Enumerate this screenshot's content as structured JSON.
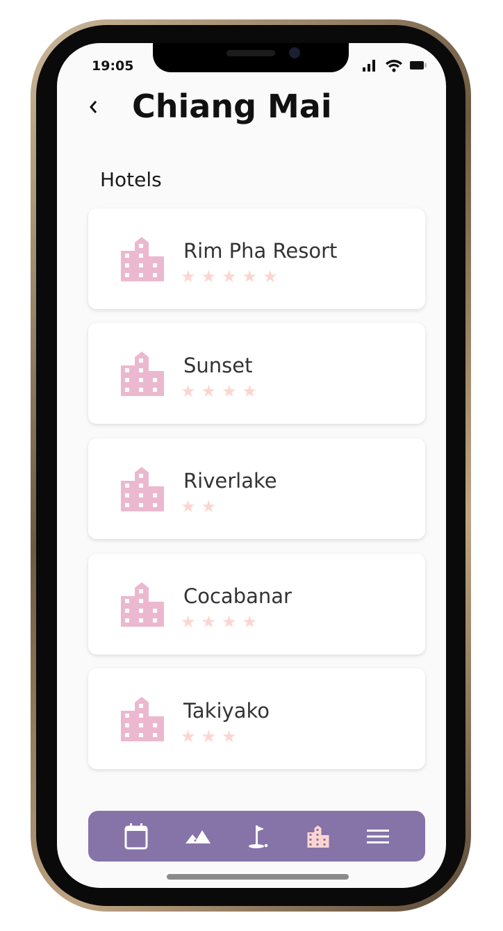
{
  "status_bar": {
    "time": "19:05"
  },
  "header": {
    "title": "Chiang Mai"
  },
  "section_title": "Hotels",
  "hotels": [
    {
      "name": "Rim Pha Resort",
      "stars": 5,
      "stars_text": "★★★★★"
    },
    {
      "name": "Sunset",
      "stars": 4,
      "stars_text": "★★★★"
    },
    {
      "name": "Riverlake",
      "stars": 2,
      "stars_text": "★★"
    },
    {
      "name": "Cocabanar",
      "stars": 4,
      "stars_text": "★★★★"
    },
    {
      "name": "Takiyako",
      "stars": 3,
      "stars_text": "★★★"
    }
  ],
  "nav": {
    "items": [
      "calendar-icon",
      "mountain-icon",
      "golf-icon",
      "hotel-icon",
      "menu-icon"
    ],
    "active": "hotel-icon"
  },
  "colors": {
    "nav_bg": "#8673a8",
    "hotel_icon": "#ebb8cf",
    "star": "#fdd5d0",
    "active_icon": "#fdd5d0"
  }
}
